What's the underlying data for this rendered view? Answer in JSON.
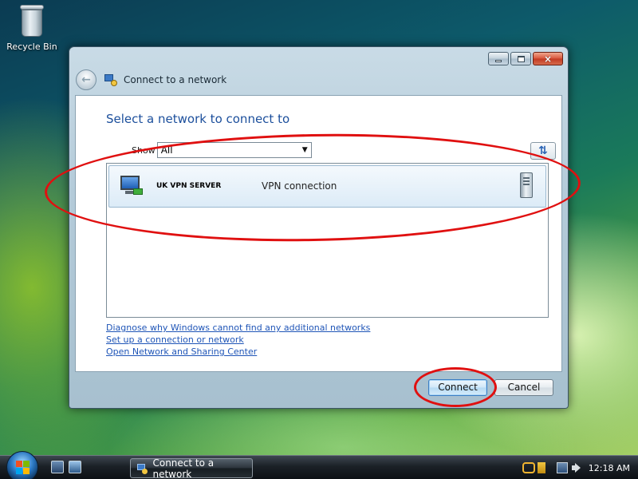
{
  "desktop": {
    "icons": [
      {
        "label": "Recycle Bin",
        "icon": "recycle-bin-icon"
      }
    ]
  },
  "window": {
    "title": "Connect to a network",
    "heading": "Select a network to connect to",
    "show_label": "Show",
    "show_value": "All",
    "networks": [
      {
        "name": "UK VPN SERVER",
        "type": "VPN connection",
        "icon": "vpn-network-icon",
        "status_icon": "server-icon"
      }
    ],
    "links": [
      "Diagnose why Windows cannot find any additional networks",
      "Set up a connection or network",
      "Open Network and Sharing Center"
    ],
    "buttons": {
      "connect": "Connect",
      "cancel": "Cancel"
    },
    "controls": {
      "minimize": "minimize-icon",
      "maximize": "maximize-icon",
      "close": "×"
    }
  },
  "taskbar": {
    "task_label": "Connect to a network",
    "clock": "12:18 AM"
  },
  "colors": {
    "heading": "#1c4f9c",
    "link": "#1f55b7",
    "annotation": "#e01010"
  }
}
